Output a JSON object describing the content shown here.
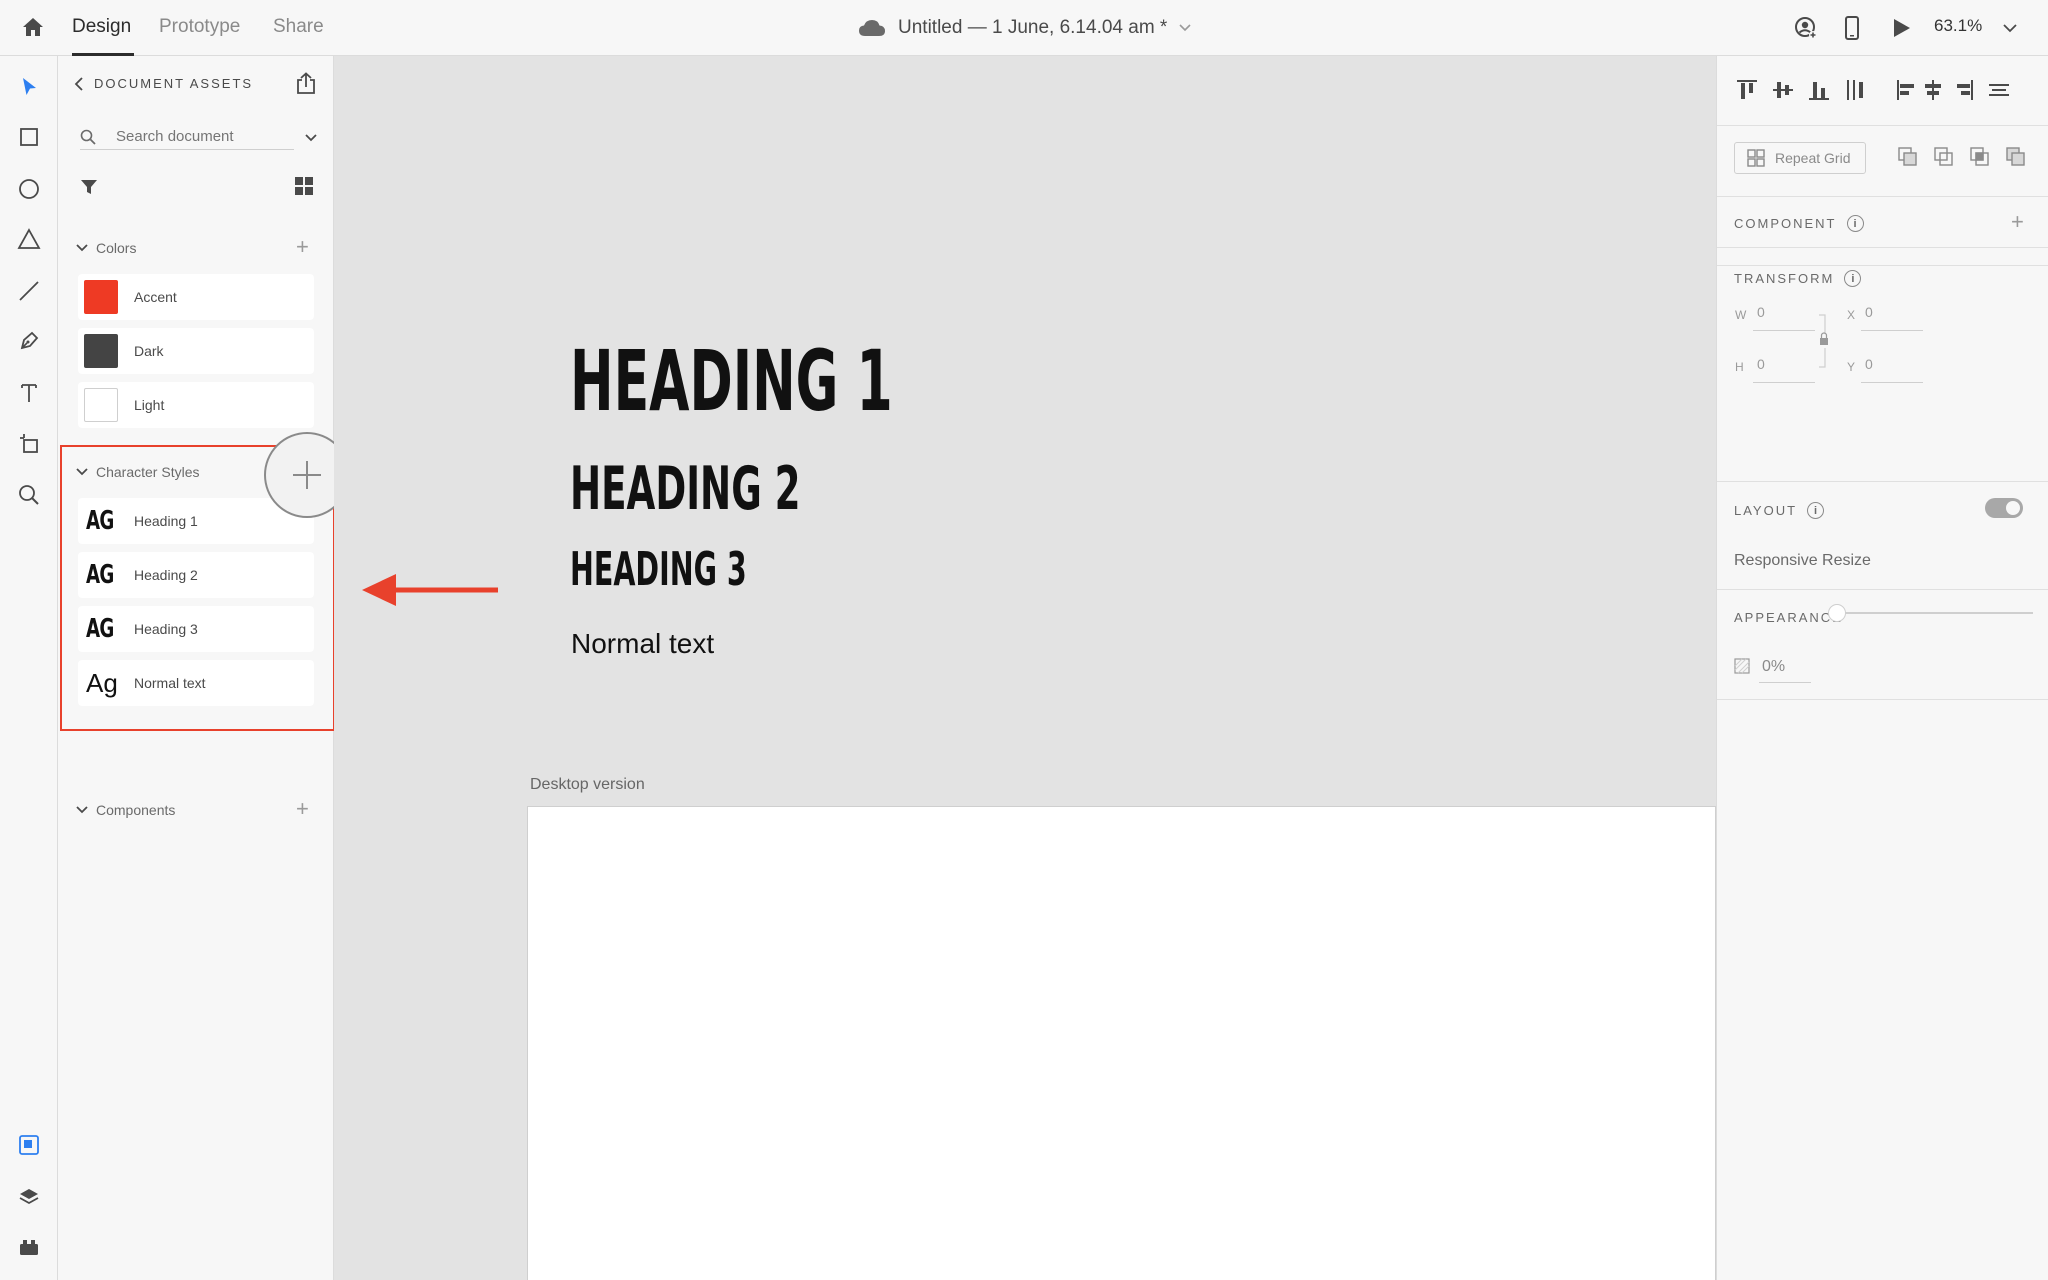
{
  "topbar": {
    "tabs": [
      "Design",
      "Prototype",
      "Share"
    ],
    "doc_title": "Untitled — 1 June, 6.14.04 am *",
    "zoom": "63.1%"
  },
  "assets": {
    "header": "DOCUMENT ASSETS",
    "search_placeholder": "Search document",
    "colors_title": "Colors",
    "colors": [
      {
        "label": "Accent",
        "color": "#ee3a24"
      },
      {
        "label": "Dark",
        "color": "#444444"
      },
      {
        "label": "Light",
        "color": "#ffffff"
      }
    ],
    "char_title": "Character Styles",
    "char_styles": [
      {
        "glyph": "AG",
        "label": "Heading 1"
      },
      {
        "glyph": "AG",
        "label": "Heading 2"
      },
      {
        "glyph": "AG",
        "label": "Heading 3"
      },
      {
        "glyph": "Ag",
        "label": "Normal text"
      }
    ],
    "components_title": "Components"
  },
  "canvas": {
    "heading1": "HEADING 1",
    "heading2": "HEADING 2",
    "heading3": "HEADING 3",
    "normal": "Normal text",
    "artboard_label": "Desktop version",
    "arrow_color": "#e8412c"
  },
  "right": {
    "repeat_grid": "Repeat Grid",
    "component": "COMPONENT",
    "transform": "TRANSFORM",
    "w_label": "W",
    "w_value": "0",
    "x_label": "X",
    "x_value": "0",
    "h_label": "H",
    "h_value": "0",
    "y_label": "Y",
    "y_value": "0",
    "layout": "LAYOUT",
    "responsive_resize": "Responsive Resize",
    "appearance": "APPEARANCE",
    "opacity": "0%"
  }
}
